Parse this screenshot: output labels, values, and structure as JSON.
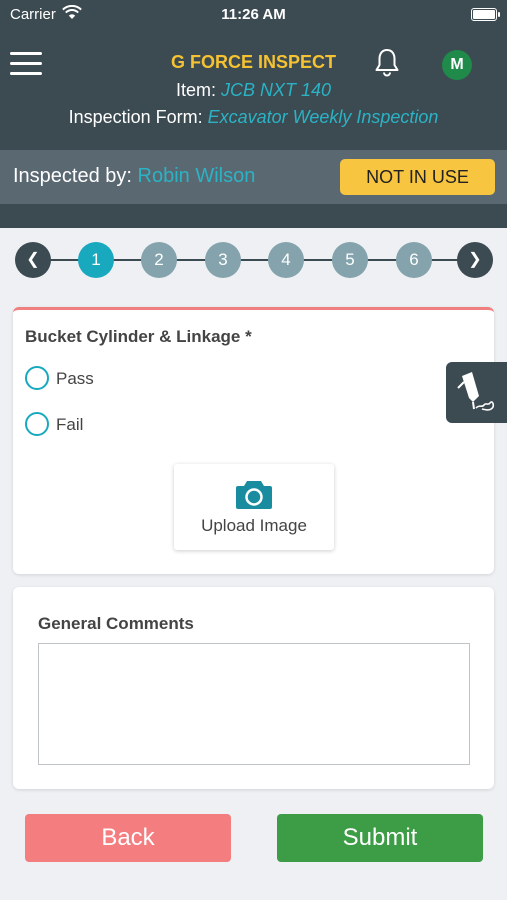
{
  "status_bar": {
    "carrier": "Carrier",
    "time": "11:26 AM"
  },
  "header": {
    "app_title": "G FORCE INSPECT",
    "item_label": "Item:",
    "item_value": "JCB NXT 140",
    "form_label": "Inspection Form:",
    "form_value": "Excavator Weekly Inspection",
    "avatar_initial": "M",
    "colors": {
      "background": "#3c4a52",
      "title": "#f5c232",
      "accent": "#2bb3c5"
    }
  },
  "inspector": {
    "label": "Inspected by:",
    "name": "Robin Wilson",
    "status_button": "NOT IN USE"
  },
  "stepper": {
    "steps": [
      "1",
      "2",
      "3",
      "4",
      "5",
      "6"
    ],
    "active_step": "1",
    "prev_icon": "chevron-left-icon",
    "next_icon": "chevron-right-icon"
  },
  "question": {
    "title": "Bucket Cylinder & Linkage *",
    "options": [
      "Pass",
      "Fail"
    ],
    "upload_label": "Upload Image"
  },
  "comments": {
    "label": "General Comments",
    "value": ""
  },
  "buttons": {
    "back": "Back",
    "submit": "Submit",
    "back_color": "#f47d80",
    "submit_color": "#3d9d46"
  }
}
